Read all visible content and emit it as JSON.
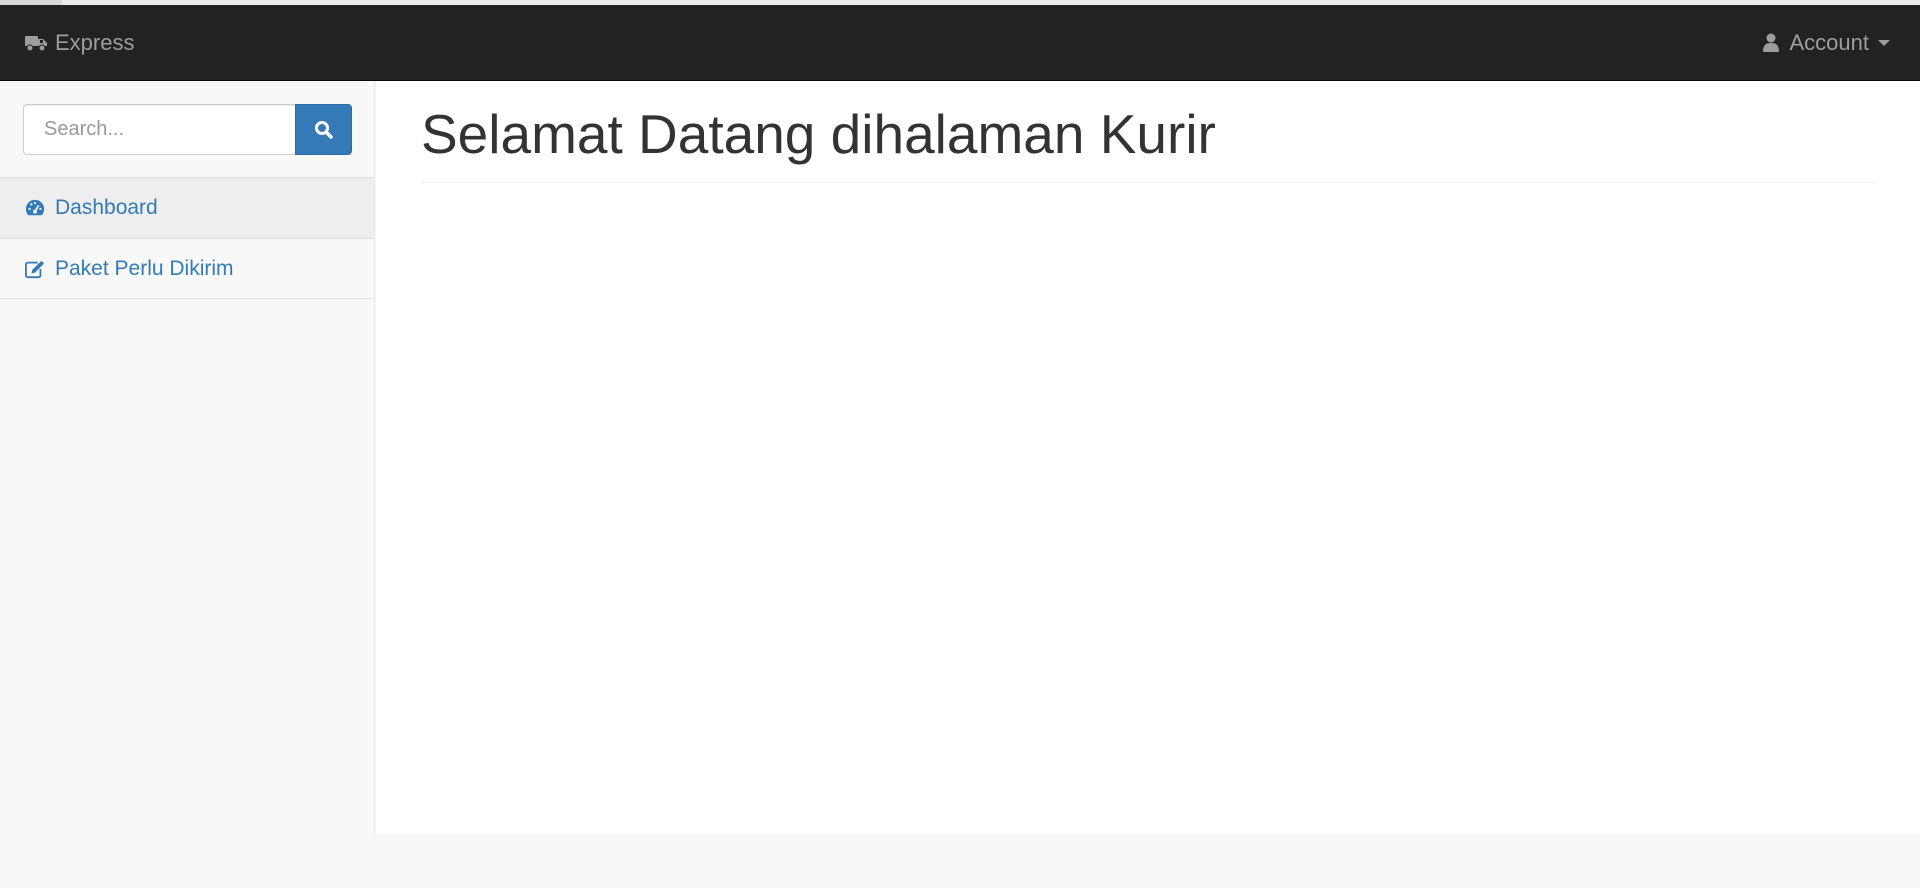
{
  "navbar": {
    "brand_label": "Express",
    "brand_icon": "truck-icon",
    "account_label": "Account",
    "account_icon": "user-icon"
  },
  "sidebar": {
    "search": {
      "placeholder": "Search...",
      "value": "",
      "button_icon": "search-icon"
    },
    "items": [
      {
        "label": "Dashboard",
        "icon": "dashboard-icon",
        "active": true
      },
      {
        "label": "Paket Perlu Dikirim",
        "icon": "edit-icon",
        "active": false
      }
    ]
  },
  "main": {
    "page_title": "Selamat Datang dihalaman Kurir"
  },
  "colors": {
    "navbar_bg": "#222222",
    "navbar_text": "#9d9d9d",
    "link": "#337ab7",
    "primary_button": "#337ab7",
    "sidebar_bg": "#f8f8f8",
    "active_item_bg": "#eeeeee"
  }
}
